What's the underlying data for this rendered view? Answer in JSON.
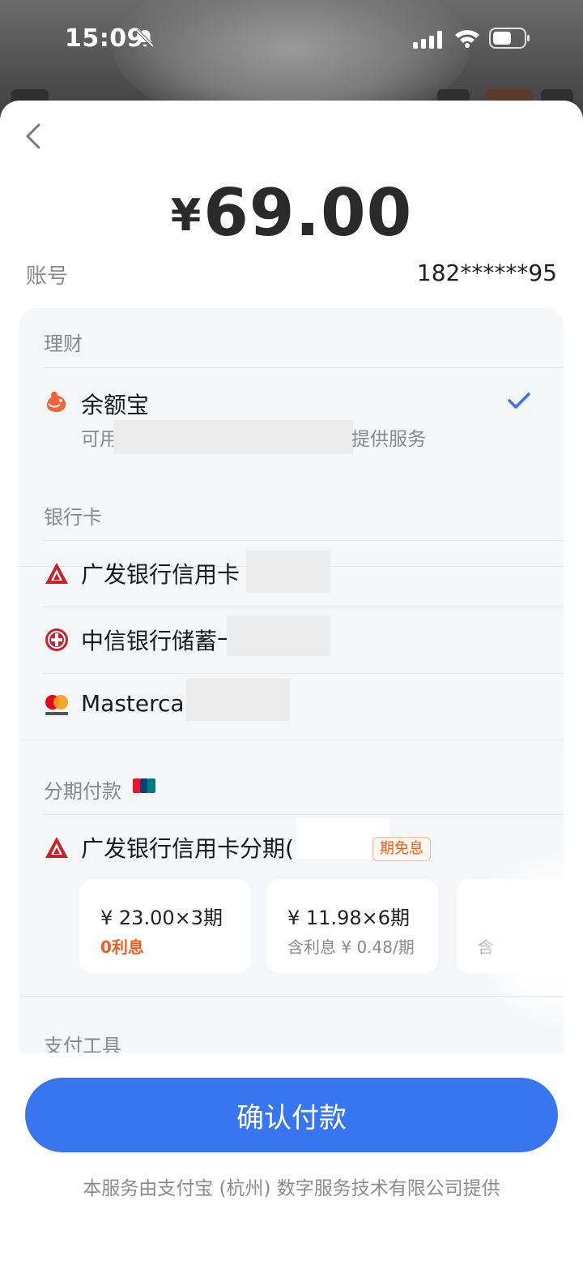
{
  "status_bar": {
    "time": "15:09"
  },
  "header": {
    "amount_currency": "¥",
    "amount_value": "69.00",
    "account_label": "账号",
    "account_value": "182******95"
  },
  "sections": {
    "wealth": {
      "title": "理财",
      "item": {
        "name": "余额宝",
        "sub_prefix": "可用",
        "sub_suffix": "提供服务",
        "selected": true
      }
    },
    "bank_cards": {
      "title": "银行卡",
      "items": [
        {
          "name": "广发银行信用卡",
          "icon": "cgb-bank-icon"
        },
        {
          "name": "中信银行储蓄卡",
          "icon": "citic-bank-icon"
        },
        {
          "name": "Mastercard",
          "icon": "mastercard-icon"
        }
      ]
    },
    "installment": {
      "title": "分期付款",
      "badge_icon": "unionpay-icon",
      "item": {
        "name": "广发银行信用卡分期(",
        "tag": "期免息"
      },
      "plans": [
        {
          "price": "¥ 23.00×3期",
          "note": "0利息"
        },
        {
          "price": "¥ 11.98×6期",
          "note": "含利息 ¥ 0.48/期"
        },
        {
          "price": "",
          "note": "含"
        }
      ]
    },
    "tools": {
      "title": "支付工具"
    }
  },
  "actions": {
    "confirm_label": "确认付款"
  },
  "footer": {
    "text": "本服务由支付宝 (杭州) 数字服务技术有限公司提供"
  },
  "colors": {
    "primary": "#3876f0",
    "accent": "#ee5f22",
    "panel": "#f5f6f8"
  }
}
